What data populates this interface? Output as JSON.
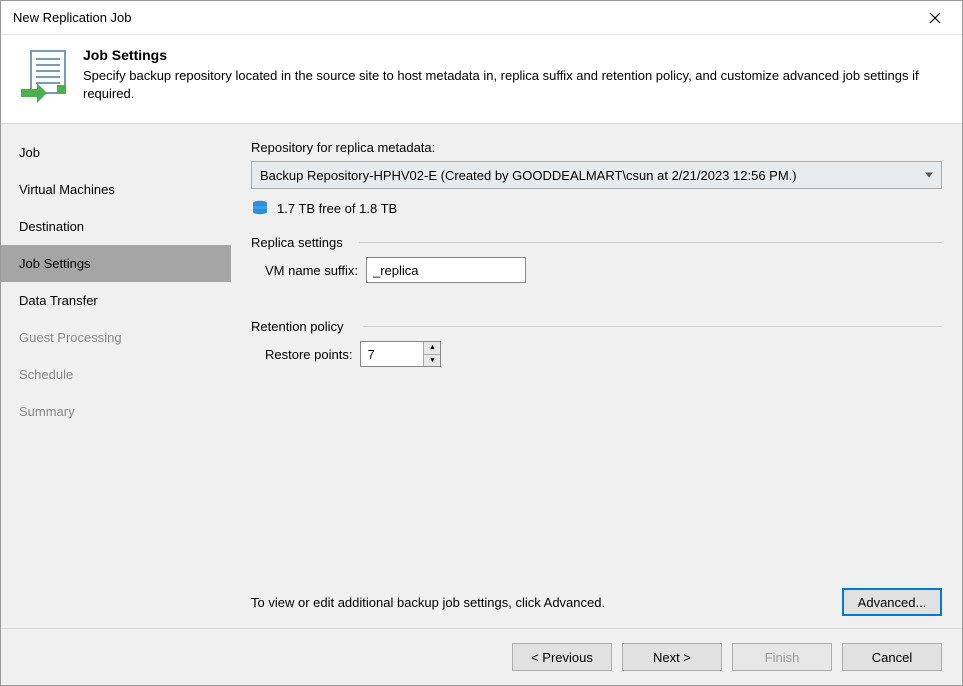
{
  "titlebar": {
    "title": "New Replication Job"
  },
  "header": {
    "title": "Job Settings",
    "description": "Specify backup repository located in the source site to host metadata in, replica suffix and retention policy, and customize advanced job settings if required."
  },
  "sidebar": {
    "items": [
      {
        "label": "Job",
        "active": false,
        "disabled": false
      },
      {
        "label": "Virtual Machines",
        "active": false,
        "disabled": false
      },
      {
        "label": "Destination",
        "active": false,
        "disabled": false
      },
      {
        "label": "Job Settings",
        "active": true,
        "disabled": false
      },
      {
        "label": "Data Transfer",
        "active": false,
        "disabled": false
      },
      {
        "label": "Guest Processing",
        "active": false,
        "disabled": true
      },
      {
        "label": "Schedule",
        "active": false,
        "disabled": true
      },
      {
        "label": "Summary",
        "active": false,
        "disabled": true
      }
    ]
  },
  "main": {
    "repo_label": "Repository for replica metadata:",
    "repo_value": "Backup Repository-HPHV02-E (Created by GOODDEALMART\\csun at 2/21/2023 12:56 PM.)",
    "storage_free": "1.7 TB free of 1.8 TB",
    "replica_section": "Replica settings",
    "suffix_label": "VM name suffix:",
    "suffix_value": "_replica",
    "retention_section": "Retention policy",
    "restore_label": "Restore points:",
    "restore_value": "7",
    "bottom_text": "To view or edit additional backup job settings, click Advanced.",
    "advanced_btn": "Advanced..."
  },
  "footer": {
    "previous": "< Previous",
    "next": "Next >",
    "finish": "Finish",
    "cancel": "Cancel"
  }
}
